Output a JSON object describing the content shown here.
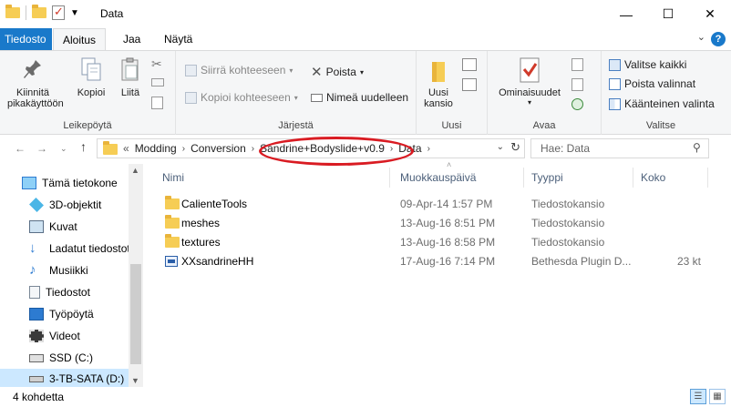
{
  "window": {
    "title": "Data",
    "minimize": "—",
    "maximize": "☐",
    "close": "✕"
  },
  "ribbon_tabs": [
    {
      "label": "Tiedosto"
    },
    {
      "label": "Aloitus"
    },
    {
      "label": "Jaa"
    },
    {
      "label": "Näytä"
    }
  ],
  "ribbon": {
    "clipboard": {
      "label": "Leikepöytä",
      "pin_line1": "Kiinnitä",
      "pin_line2": "pikakäyttöön",
      "copy": "Kopioi",
      "paste": "Liitä"
    },
    "organize": {
      "label": "Järjestä",
      "move_to": "Siirrä kohteeseen",
      "copy_to": "Kopioi kohteeseen",
      "delete": "Poista",
      "rename": "Nimeä uudelleen"
    },
    "new": {
      "label": "Uusi",
      "new_folder_line1": "Uusi",
      "new_folder_line2": "kansio"
    },
    "open": {
      "label": "Avaa",
      "properties": "Ominaisuudet"
    },
    "select": {
      "label": "Valitse",
      "select_all": "Valitse kaikki",
      "select_none": "Poista valinnat",
      "invert": "Käänteinen valinta"
    }
  },
  "address": {
    "overflow": "«",
    "crumbs": [
      "Modding",
      "Conversion",
      "Sandrine+Bodyslide+v0.9",
      "Data"
    ],
    "search_placeholder": "Hae: Data"
  },
  "nav_pane": {
    "items": [
      {
        "label": "Tämä tietokone",
        "icon": "computer-icon"
      },
      {
        "label": "3D-objektit",
        "icon": "3d-objects-icon"
      },
      {
        "label": "Kuvat",
        "icon": "pictures-icon"
      },
      {
        "label": "Ladatut tiedostot",
        "icon": "downloads-icon"
      },
      {
        "label": "Musiikki",
        "icon": "music-icon"
      },
      {
        "label": "Tiedostot",
        "icon": "documents-icon"
      },
      {
        "label": "Työpöytä",
        "icon": "desktop-icon"
      },
      {
        "label": "Videot",
        "icon": "videos-icon"
      },
      {
        "label": "SSD (C:)",
        "icon": "drive-icon"
      },
      {
        "label": "3-TB-SATA (D:)",
        "icon": "drive-icon"
      }
    ]
  },
  "file_list": {
    "columns": [
      "Nimi",
      "Muokkauspäivä",
      "Tyyppi",
      "Koko"
    ],
    "rows": [
      {
        "name": "CalienteTools",
        "date": "09-Apr-14 1:57 PM",
        "type": "Tiedostokansio",
        "size": "",
        "icon": "folder-icon"
      },
      {
        "name": "meshes",
        "date": "13-Aug-16 8:51 PM",
        "type": "Tiedostokansio",
        "size": "",
        "icon": "folder-icon"
      },
      {
        "name": "textures",
        "date": "13-Aug-16 8:58 PM",
        "type": "Tiedostokansio",
        "size": "",
        "icon": "folder-icon"
      },
      {
        "name": "XXsandrineHH",
        "date": "17-Aug-16 7:14 PM",
        "type": "Bethesda Plugin D...",
        "size": "23 kt",
        "icon": "plugin-file-icon"
      }
    ]
  },
  "status": {
    "count": "4 kohdetta"
  },
  "colors": {
    "file_tab": "#1979ca",
    "annotation_ellipse": "#d91b22",
    "folder": "#f6cd55"
  }
}
